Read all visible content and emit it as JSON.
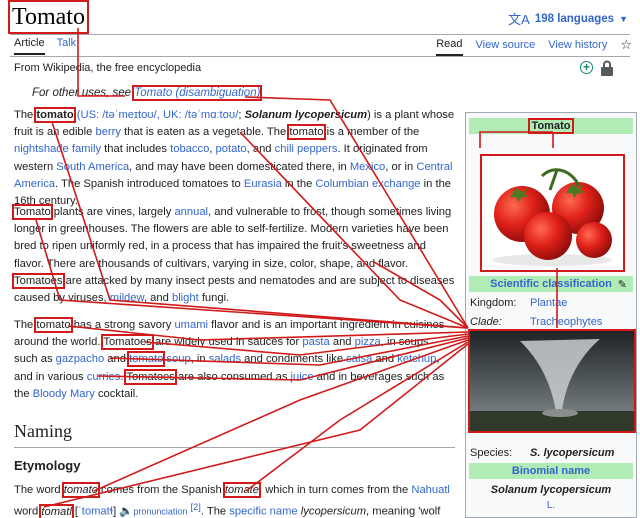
{
  "page": {
    "title": "Tomato",
    "languages": "198 languages",
    "tabs_left": [
      "Article",
      "Talk"
    ],
    "tabs_right": [
      "Read",
      "View source",
      "View history"
    ],
    "from": "From Wikipedia, the free encyclopedia"
  },
  "hatnote": {
    "prefix": "For other uses, see ",
    "link": "Tomato (disambiguation)",
    "suffix": "."
  },
  "paragraphs": {
    "p1": {
      "t1": "The ",
      "tomato": "tomato",
      "us": "(US: /təˈmeɪtoʊ/",
      "uk": ", UK: /təˈmɑːtoʊ/",
      "t2": "; ",
      "sci": "Solanum lycopersicum",
      "t3": ") is a plant whose fruit is an edible ",
      "berry": "berry",
      "t4": " that is eaten as a vegetable. The ",
      "tomato2": "tomato",
      "t5": " is a member of the ",
      "nightshade": "nightshade family",
      "t6": " that includes ",
      "tobacco": "tobacco",
      "t7": ", ",
      "potato": "potato",
      "t8": ", and ",
      "chili": "chili peppers",
      "t9": ". It originated from western ",
      "southam": "South America",
      "t10": ", and may have been domesticated there, in ",
      "mexico": "Mexico",
      "t11": ", or in ",
      "central": "Central America",
      "t12": ". The Spanish introduced tomatoes to ",
      "eurasia": "Eurasia",
      "t13": " in the ",
      "columbian": "Columbian exchange",
      "t14": " in the 16th century."
    },
    "p2": {
      "tomato": "Tomato",
      "t1": " plants are vines, largely ",
      "annual": "annual",
      "t2": ", and vulnerable to frost, though sometimes living longer in greenhouses. The flowers are able to self-fertilize. Modern varieties have been bred to ripen uniformly red, in a process that has impaired the fruit's sweetness and flavor. There are thousands of cultivars, varying in size, color, shape, and flavor. ",
      "tomatoes": "Tomatoes",
      "t3": " are attacked by many insect pests and nematodes and are subject to diseases caused by viruses, ",
      "mildew": "mildew",
      "t4": ", and ",
      "blight": "blight",
      "t5": " fungi."
    },
    "p3": {
      "t1": "The ",
      "tomato": "tomato",
      "t2": " has a strong savory ",
      "umami": "umami",
      "t3": " flavor and is an important ingredient in cuisines around the world. ",
      "tomatoes": "Tomatoes",
      "t4": " are widely used in sauces for ",
      "pasta": "pasta",
      "t5": " and ",
      "pizza": "pizza",
      "t6": ", in soups such as ",
      "gazpacho": "gazpacho",
      "t7": " and ",
      "tomato2": "tomato",
      "soup": " soup",
      "t8": ", in ",
      "salads": "salads",
      "t9": " and condiments like ",
      "salsa": "salsa",
      "t10": " and ",
      "ketchup": "ketchup",
      "t11": ", and in various ",
      "curries": "curries",
      "t12": ". ",
      "tomatoes2": "Tomatoes",
      "t13": " are also consumed as ",
      "juice": "juice",
      "t14": " and in beverages such as the ",
      "bloodymary": "Bloody Mary",
      "t15": " cocktail."
    },
    "naming": "Naming",
    "etymology": "Etymology",
    "p4": {
      "t1": "The word ",
      "tomato": "tomato",
      "t2": " comes from the Spanish ",
      "tomate": "tomate",
      "t3": ", which in turn comes from the ",
      "nahuatl": "Nahuatl",
      "t4": " word ",
      "tomatl": "tomatl",
      "t5": " [",
      "tomatl2": "ˈtomatɬ",
      "t6": "] ",
      "pron": "pronunciation",
      "t7": " ",
      "ref": "[2]",
      "t8": ". The ",
      "specific": "specific name",
      "t9": " ",
      "lyco": "lycopersicum",
      "t10": ", meaning 'wolf peach',"
    }
  },
  "infobox": {
    "title": "Tomato",
    "scientific_classification": "Scientific classification",
    "kingdom_label": "Kingdom:",
    "kingdom_value": "Plantae",
    "clade_label": "Clade:",
    "clade_value": "Tracheophytes",
    "species_label": "Species:",
    "species_value": "S. lycopersicum",
    "binomial_name": "Binomial name",
    "binomial_value": "Solanum lycopersicum",
    "authority": "L."
  },
  "icons": [
    "translate-icon",
    "chevron-down-icon",
    "star-icon",
    "plus-icon",
    "lock-icon",
    "pencil-icon",
    "speaker-icon"
  ],
  "colors": {
    "link": "#3366cc",
    "highlight": "#d11a1a",
    "infobox_band": "#b1ebb5"
  }
}
